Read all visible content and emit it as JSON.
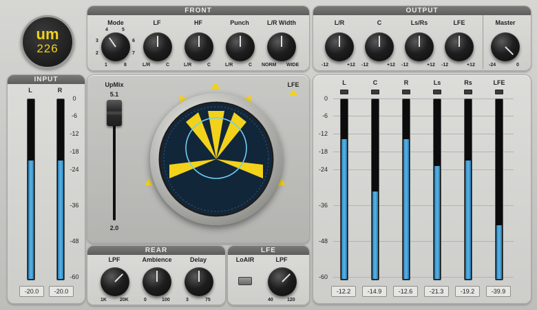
{
  "logo": {
    "brand": "UM",
    "model": "226"
  },
  "front": {
    "title": "FRONT",
    "knobs": [
      {
        "label": "Mode",
        "marks": [
          "4",
          "5",
          "3",
          "6",
          "2",
          "7",
          "1",
          "8"
        ]
      },
      {
        "label": "LF",
        "min": "L/R",
        "max": "C"
      },
      {
        "label": "HF",
        "min": "L/R",
        "max": "C"
      },
      {
        "label": "Punch",
        "min": "L/R",
        "max": "C"
      },
      {
        "label": "L/R Width",
        "min": "NORM",
        "max": "WIDE"
      }
    ]
  },
  "output_section": {
    "title": "OUTPUT",
    "knobs": [
      {
        "label": "L/R",
        "min": "-12",
        "max": "+12"
      },
      {
        "label": "C",
        "min": "-12",
        "max": "+12"
      },
      {
        "label": "Ls/Rs",
        "min": "-12",
        "max": "+12"
      },
      {
        "label": "LFE",
        "min": "-12",
        "max": "+12"
      }
    ],
    "master": {
      "label": "Master",
      "min": "-24",
      "max": "0"
    }
  },
  "input": {
    "title": "INPUT",
    "scale": [
      "0",
      "-6",
      "-12",
      "-18",
      "-24",
      "-36",
      "-48",
      "-60"
    ],
    "channels": [
      {
        "label": "L",
        "value": "-20.0",
        "level": 0.66
      },
      {
        "label": "R",
        "value": "-20.0",
        "level": 0.66
      }
    ]
  },
  "center": {
    "upmix_label": "UpMix",
    "upmix_top": "5.1",
    "upmix_bottom": "2.0",
    "lfe_label": "LFE"
  },
  "meters": {
    "scale": [
      "0",
      "-6",
      "-12",
      "-18",
      "-24",
      "-36",
      "-48",
      "-60"
    ],
    "channels": [
      {
        "label": "L",
        "value": "-12.2",
        "level": 0.78
      },
      {
        "label": "C",
        "value": "-14.9",
        "level": 0.49
      },
      {
        "label": "R",
        "value": "-12.6",
        "level": 0.78
      },
      {
        "label": "Ls",
        "value": "-21.3",
        "level": 0.63
      },
      {
        "label": "Rs",
        "value": "-19.2",
        "level": 0.66
      },
      {
        "label": "LFE",
        "value": "-39.9",
        "level": 0.3
      }
    ]
  },
  "rear": {
    "title": "REAR",
    "knobs": [
      {
        "label": "LPF",
        "min": "1K",
        "max": "20K"
      },
      {
        "label": "Ambience",
        "min": "0",
        "max": "100"
      },
      {
        "label": "Delay",
        "min": "3",
        "max": "75"
      }
    ]
  },
  "lfe_section": {
    "title": "LFE",
    "loair_label": "LoAIR",
    "knob": {
      "label": "LPF",
      "min": "40",
      "max": "120"
    }
  },
  "colors": {
    "meter": "#4aa8dc",
    "accent": "#f2d21b",
    "scope_bg": "#12263a"
  }
}
